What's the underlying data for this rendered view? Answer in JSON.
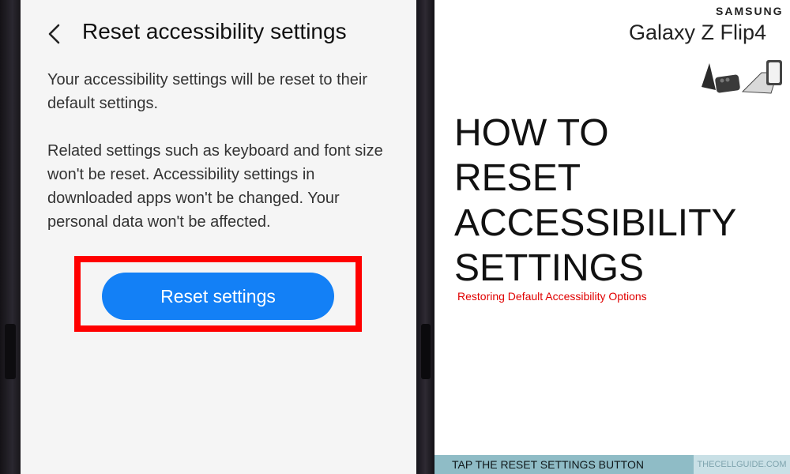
{
  "screen": {
    "title": "Reset accessibility settings",
    "paragraph1": "Your accessibility settings will be reset to their default settings.",
    "paragraph2": "Related settings such as keyboard and font size won't be reset. Accessibility settings in downloaded apps won't be changed. Your personal data won't be affected.",
    "reset_button_label": "Reset settings"
  },
  "brand": {
    "maker": "SAMSUNG",
    "model": "Galaxy Z Flip4"
  },
  "article": {
    "headline_lines": [
      "HOW TO",
      "RESET",
      "ACCESSIBILITY",
      "SETTINGS"
    ],
    "subtitle": "Restoring Default Accessibility Options",
    "footer_caption": "TAP THE RESET SETTINGS BUTTON",
    "site": "THECELLGUIDE.COM"
  },
  "colors": {
    "button": "#1380f6",
    "highlight": "#ff0000",
    "subtitle": "#e00000",
    "footer_bar": "#8fbcc6"
  }
}
